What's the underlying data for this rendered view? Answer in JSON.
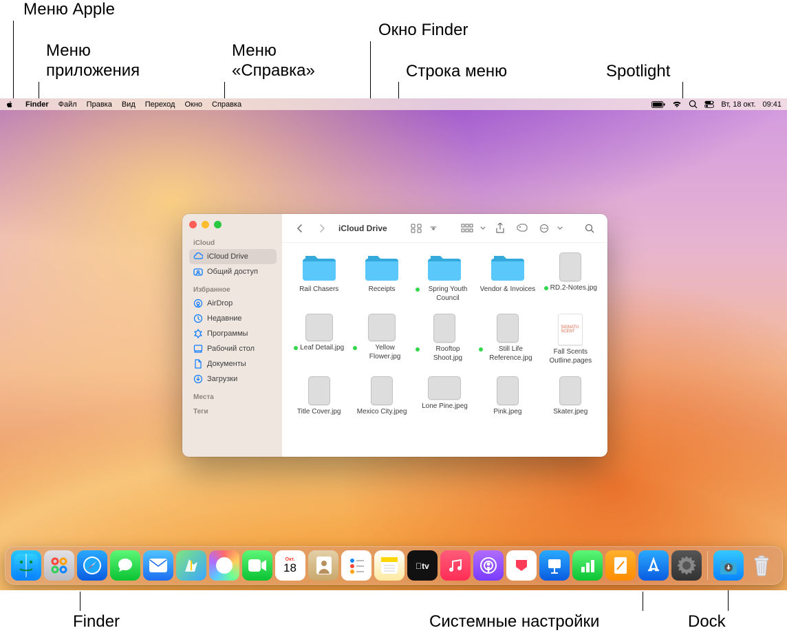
{
  "callouts": {
    "apple_menu": "Меню Apple",
    "app_menu": "Меню\nприложения",
    "help_menu": "Меню\n«Справка»",
    "finder_window": "Окно Finder",
    "menu_bar": "Строка меню",
    "spotlight": "Spotlight",
    "finder": "Finder",
    "system_settings": "Системные настройки",
    "dock": "Dock"
  },
  "menubar": {
    "app": "Finder",
    "items": [
      "Файл",
      "Правка",
      "Вид",
      "Переход",
      "Окно",
      "Справка"
    ],
    "status": {
      "date": "Вт, 18 окт.",
      "time": "09:41"
    }
  },
  "finder": {
    "title": "iCloud Drive",
    "sidebar": {
      "sections": [
        {
          "head": "iCloud",
          "items": [
            {
              "label": "iCloud Drive",
              "icon": "cloud",
              "selected": true
            },
            {
              "label": "Общий доступ",
              "icon": "shared"
            }
          ]
        },
        {
          "head": "Избранное",
          "items": [
            {
              "label": "AirDrop",
              "icon": "airdrop"
            },
            {
              "label": "Недавние",
              "icon": "clock"
            },
            {
              "label": "Программы",
              "icon": "apps"
            },
            {
              "label": "Рабочий стол",
              "icon": "desktop"
            },
            {
              "label": "Документы",
              "icon": "doc"
            },
            {
              "label": "Загрузки",
              "icon": "downloads"
            }
          ]
        },
        {
          "head": "Места",
          "items": []
        },
        {
          "head": "Теги",
          "items": []
        }
      ]
    },
    "files": [
      {
        "label": "Rail Chasers",
        "type": "folder"
      },
      {
        "label": "Receipts",
        "type": "folder"
      },
      {
        "label": "Spring Youth Council",
        "type": "folder",
        "tag": true
      },
      {
        "label": "Vendor & Invoices",
        "type": "folder"
      },
      {
        "label": "RD.2-Notes.jpg",
        "type": "img",
        "shape": "port",
        "fill": "fill-rd2",
        "tag": true
      },
      {
        "label": "Leaf Detail.jpg",
        "type": "img",
        "shape": "sq",
        "fill": "fill-green",
        "tag": true
      },
      {
        "label": "Yellow Flower.jpg",
        "type": "img",
        "shape": "sq",
        "fill": "fill-yellow",
        "tag": true
      },
      {
        "label": "Rooftop Shoot.jpg",
        "type": "img",
        "shape": "port",
        "fill": "fill-sky",
        "tag": true
      },
      {
        "label": "Still Life Reference.jpg",
        "type": "img",
        "shape": "port",
        "fill": "fill-maroon",
        "tag": true
      },
      {
        "label": "Fall Scents Outline.pages",
        "type": "doc",
        "text": "SIGNATU\nSCENT"
      },
      {
        "label": "Title Cover.jpg",
        "type": "img",
        "shape": "port",
        "fill": "fill-title"
      },
      {
        "label": "Mexico City.jpeg",
        "type": "img",
        "shape": "port",
        "fill": "fill-city"
      },
      {
        "label": "Lone Pine.jpeg",
        "type": "img",
        "shape": "land",
        "fill": "fill-pine"
      },
      {
        "label": "Pink.jpeg",
        "type": "img",
        "shape": "port",
        "fill": "fill-pink"
      },
      {
        "label": "Skater.jpeg",
        "type": "img",
        "shape": "port",
        "fill": "fill-skater"
      }
    ]
  },
  "dock": {
    "apps": [
      {
        "name": "finder",
        "bg": "linear-gradient(180deg,#29c6ff,#0a84ff)"
      },
      {
        "name": "launchpad",
        "bg": "linear-gradient(180deg,#e0e0e5,#bcbcc2)"
      },
      {
        "name": "safari",
        "bg": "linear-gradient(180deg,#2aa9ff,#0a5ce0)"
      },
      {
        "name": "messages",
        "bg": "linear-gradient(180deg,#5df777,#0bc233)"
      },
      {
        "name": "mail",
        "bg": "linear-gradient(180deg,#4fc3ff,#1e6ff0)"
      },
      {
        "name": "maps",
        "bg": "linear-gradient(135deg,#7fe57f,#3aa6ff)"
      },
      {
        "name": "photos",
        "bg": "conic-gradient(#ff6b6b,#ffcf5c,#6bff95,#5cc9ff,#b06bff,#ff6b6b)"
      },
      {
        "name": "facetime",
        "bg": "linear-gradient(180deg,#5df777,#0bc233)"
      },
      {
        "name": "calendar",
        "bg": "#fff"
      },
      {
        "name": "contacts",
        "bg": "linear-gradient(180deg,#e3cfa8,#c9a86c)"
      },
      {
        "name": "reminders",
        "bg": "#fff"
      },
      {
        "name": "notes",
        "bg": "linear-gradient(180deg,#fff,#ffe9a0)"
      },
      {
        "name": "tv",
        "bg": "#111"
      },
      {
        "name": "music",
        "bg": "linear-gradient(180deg,#ff5c7a,#ff2d55)"
      },
      {
        "name": "podcasts",
        "bg": "linear-gradient(180deg,#b06cff,#7a3cff)"
      },
      {
        "name": "news",
        "bg": "#fff"
      },
      {
        "name": "keynote",
        "bg": "linear-gradient(180deg,#2aa9ff,#0a5ce0)"
      },
      {
        "name": "numbers",
        "bg": "linear-gradient(180deg,#5df777,#0bc233)"
      },
      {
        "name": "pages",
        "bg": "linear-gradient(180deg,#ffb02e,#ff8c00)"
      },
      {
        "name": "appstore",
        "bg": "linear-gradient(180deg,#2aa9ff,#0a5ce0)"
      },
      {
        "name": "settings",
        "bg": "linear-gradient(180deg,#555,#333)"
      }
    ],
    "tail": [
      {
        "name": "downloads",
        "bg": "linear-gradient(180deg,#34c8ff,#0a84ff)"
      },
      {
        "name": "trash",
        "bg": "transparent"
      }
    ],
    "calendar": {
      "month": "Окт.",
      "day": "18"
    }
  }
}
